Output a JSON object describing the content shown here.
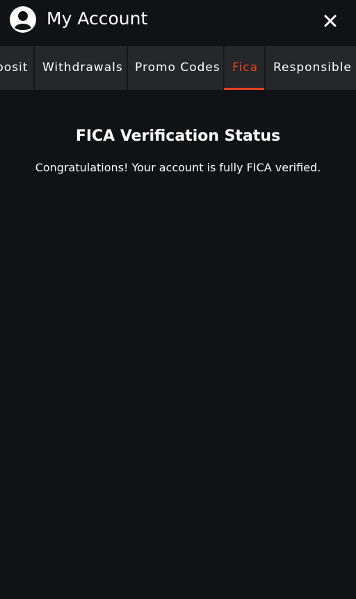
{
  "header": {
    "title": "My Account",
    "avatar_icon": "user-circle-icon",
    "close_icon": "close-icon"
  },
  "tabs": [
    {
      "label": "posit",
      "active": false
    },
    {
      "label": "Withdrawals",
      "active": false
    },
    {
      "label": "Promo Codes",
      "active": false
    },
    {
      "label": "Fica",
      "active": true
    },
    {
      "label": "Responsible",
      "active": false
    }
  ],
  "main": {
    "title": "FICA Verification Status",
    "message": "Congratulations! Your account is fully FICA verified."
  },
  "colors": {
    "background": "#111216",
    "tab_bar": "#26272b",
    "accent": "#e8431d",
    "text": "#ffffff"
  }
}
